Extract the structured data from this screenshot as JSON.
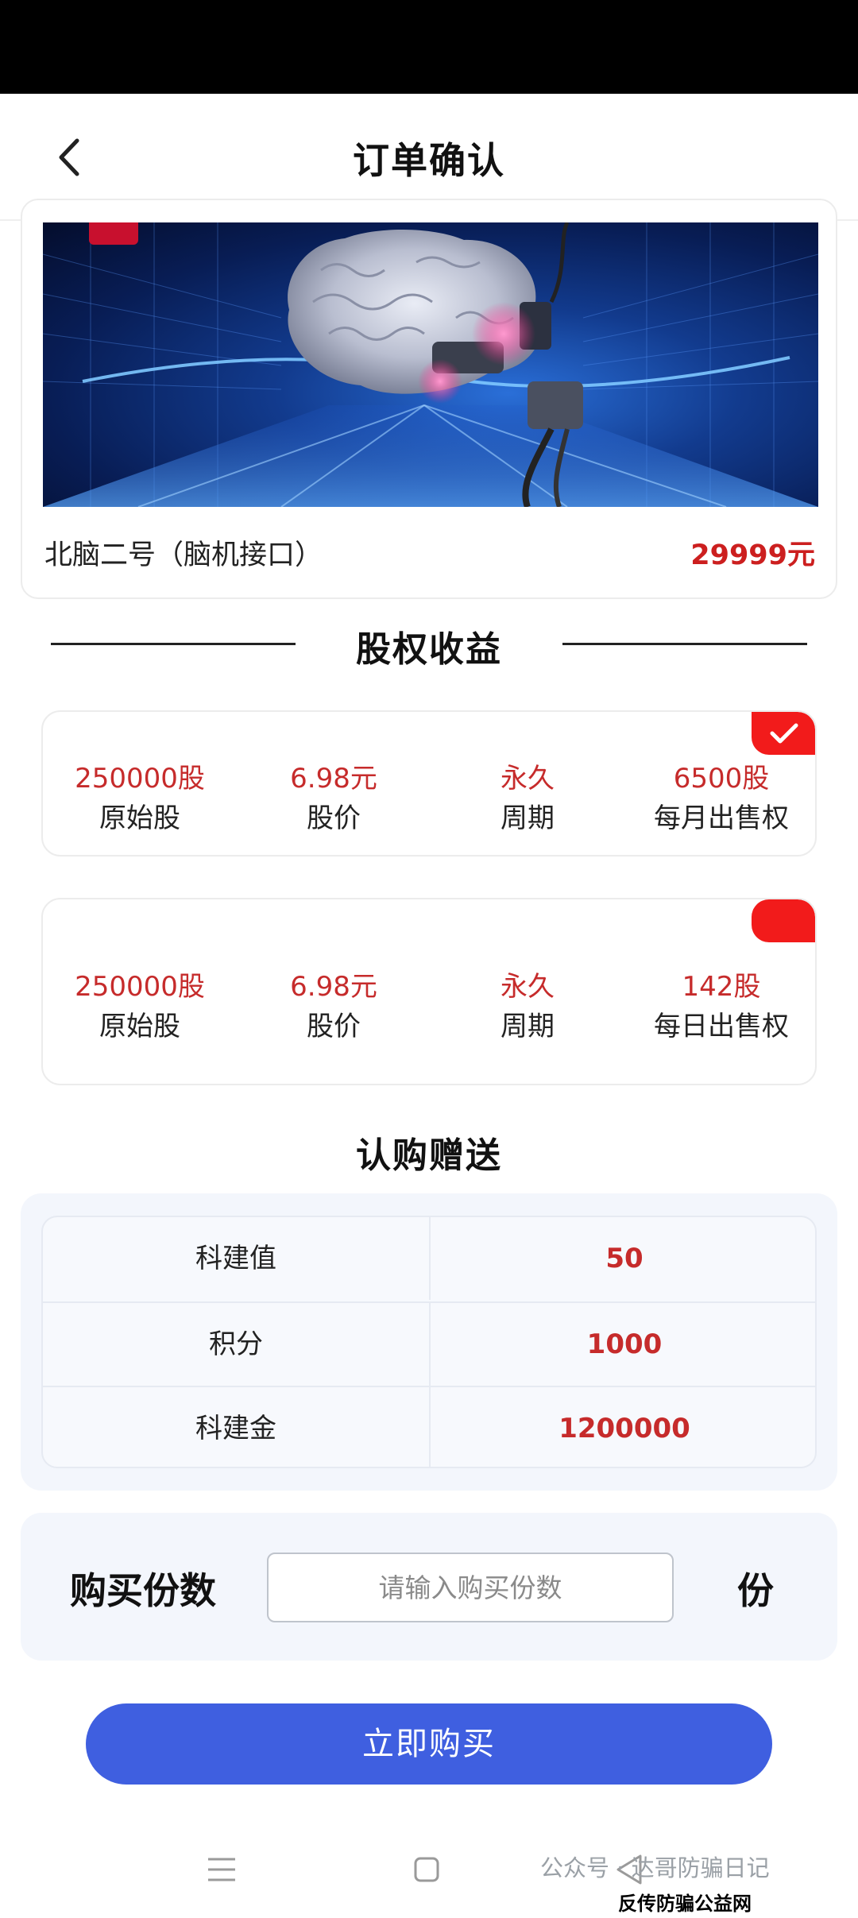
{
  "header": {
    "title": "订单确认"
  },
  "product": {
    "name": "北脑二号（脑机接口）",
    "price": "29999元"
  },
  "equity_section": {
    "title": "股权收益"
  },
  "plans": [
    {
      "selected": true,
      "columns": [
        {
          "value": "250000股",
          "label": "原始股"
        },
        {
          "value": "6.98元",
          "label": "股价"
        },
        {
          "value": "永久",
          "label": "周期"
        },
        {
          "value": "6500股",
          "label": "每月出售权"
        }
      ]
    },
    {
      "selected": false,
      "columns": [
        {
          "value": "250000股",
          "label": "原始股"
        },
        {
          "value": "6.98元",
          "label": "股价"
        },
        {
          "value": "永久",
          "label": "周期"
        },
        {
          "value": "142股",
          "label": "每日出售权"
        }
      ]
    }
  ],
  "gift_section": {
    "title": "认购赠送",
    "rows": [
      {
        "key": "科建值",
        "value": "50"
      },
      {
        "key": "积分",
        "value": "1000"
      },
      {
        "key": "科建金",
        "value": "1200000"
      }
    ]
  },
  "quantity": {
    "label": "购买份数",
    "placeholder": "请输入购买份数",
    "value": "",
    "unit": "份"
  },
  "actions": {
    "buy_label": "立即购买"
  },
  "watermark": {
    "text": "公众号 · 达哥防骗日记",
    "site": "反传防骗公益网 www.wazi.cc"
  },
  "colors": {
    "accent_red": "#c62b2b",
    "check_red": "#f21b1b",
    "button_blue": "#3f5fe0",
    "panel_bg": "#f3f6fc"
  },
  "icons": {
    "back": "chevron-left-icon",
    "selected": "checkmark-icon",
    "nav_menu": "menu-icon",
    "nav_home": "square-home-icon",
    "nav_back": "triangle-back-icon"
  }
}
